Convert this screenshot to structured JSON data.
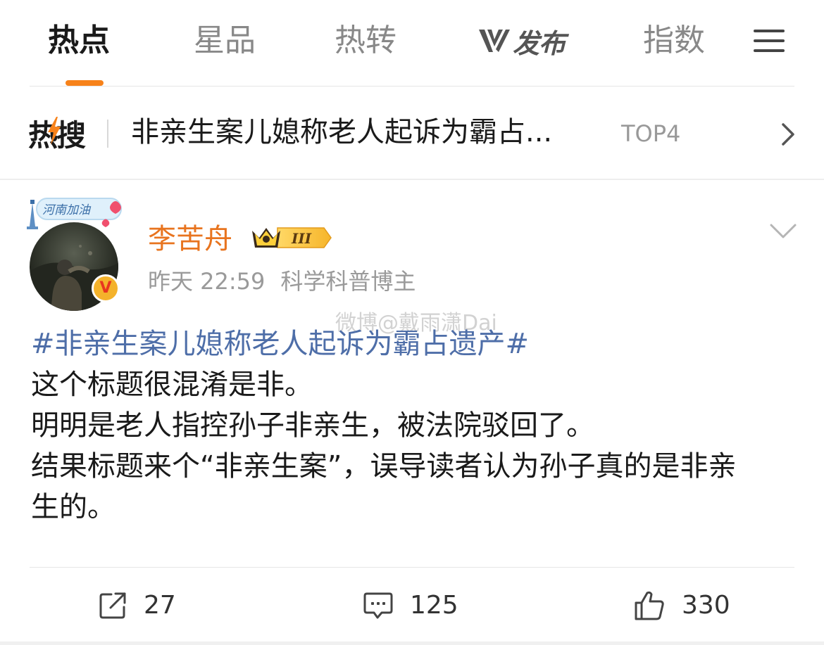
{
  "tabs": [
    {
      "label": "热点",
      "active": true
    },
    {
      "label": "星品",
      "active": false
    },
    {
      "label": "热转",
      "active": false
    },
    {
      "label": "发布",
      "active": false
    },
    {
      "label": "指数",
      "active": false
    }
  ],
  "hot_search": {
    "logo_label": "热搜",
    "title": "非亲生案儿媳称老人起诉为霸占...",
    "rank": "TOP4"
  },
  "post": {
    "avatar_frame_text": "河南加油",
    "username": "李苦舟",
    "vip_level": "III",
    "verify_mark": "V",
    "time": "昨天 22:59",
    "tag": "科学科普博主",
    "watermark": "微博@戴雨潇Dai",
    "hashtag": "#非亲生案儿媳称老人起诉为霸占遗产#",
    "lines": [
      "这个标题很混淆是非。",
      "明明是老人指控孙子非亲生，被法院驳回了。",
      "结果标题来个“非亲生案”，误导读者认为孙子真的是非亲",
      "生的。"
    ]
  },
  "actions": {
    "repost_count": "27",
    "comment_count": "125",
    "like_count": "330"
  },
  "colors": {
    "accent": "#f7821a",
    "username": "#e8741f",
    "hashtag": "#4e6ea8",
    "muted": "#9a9a9a"
  }
}
